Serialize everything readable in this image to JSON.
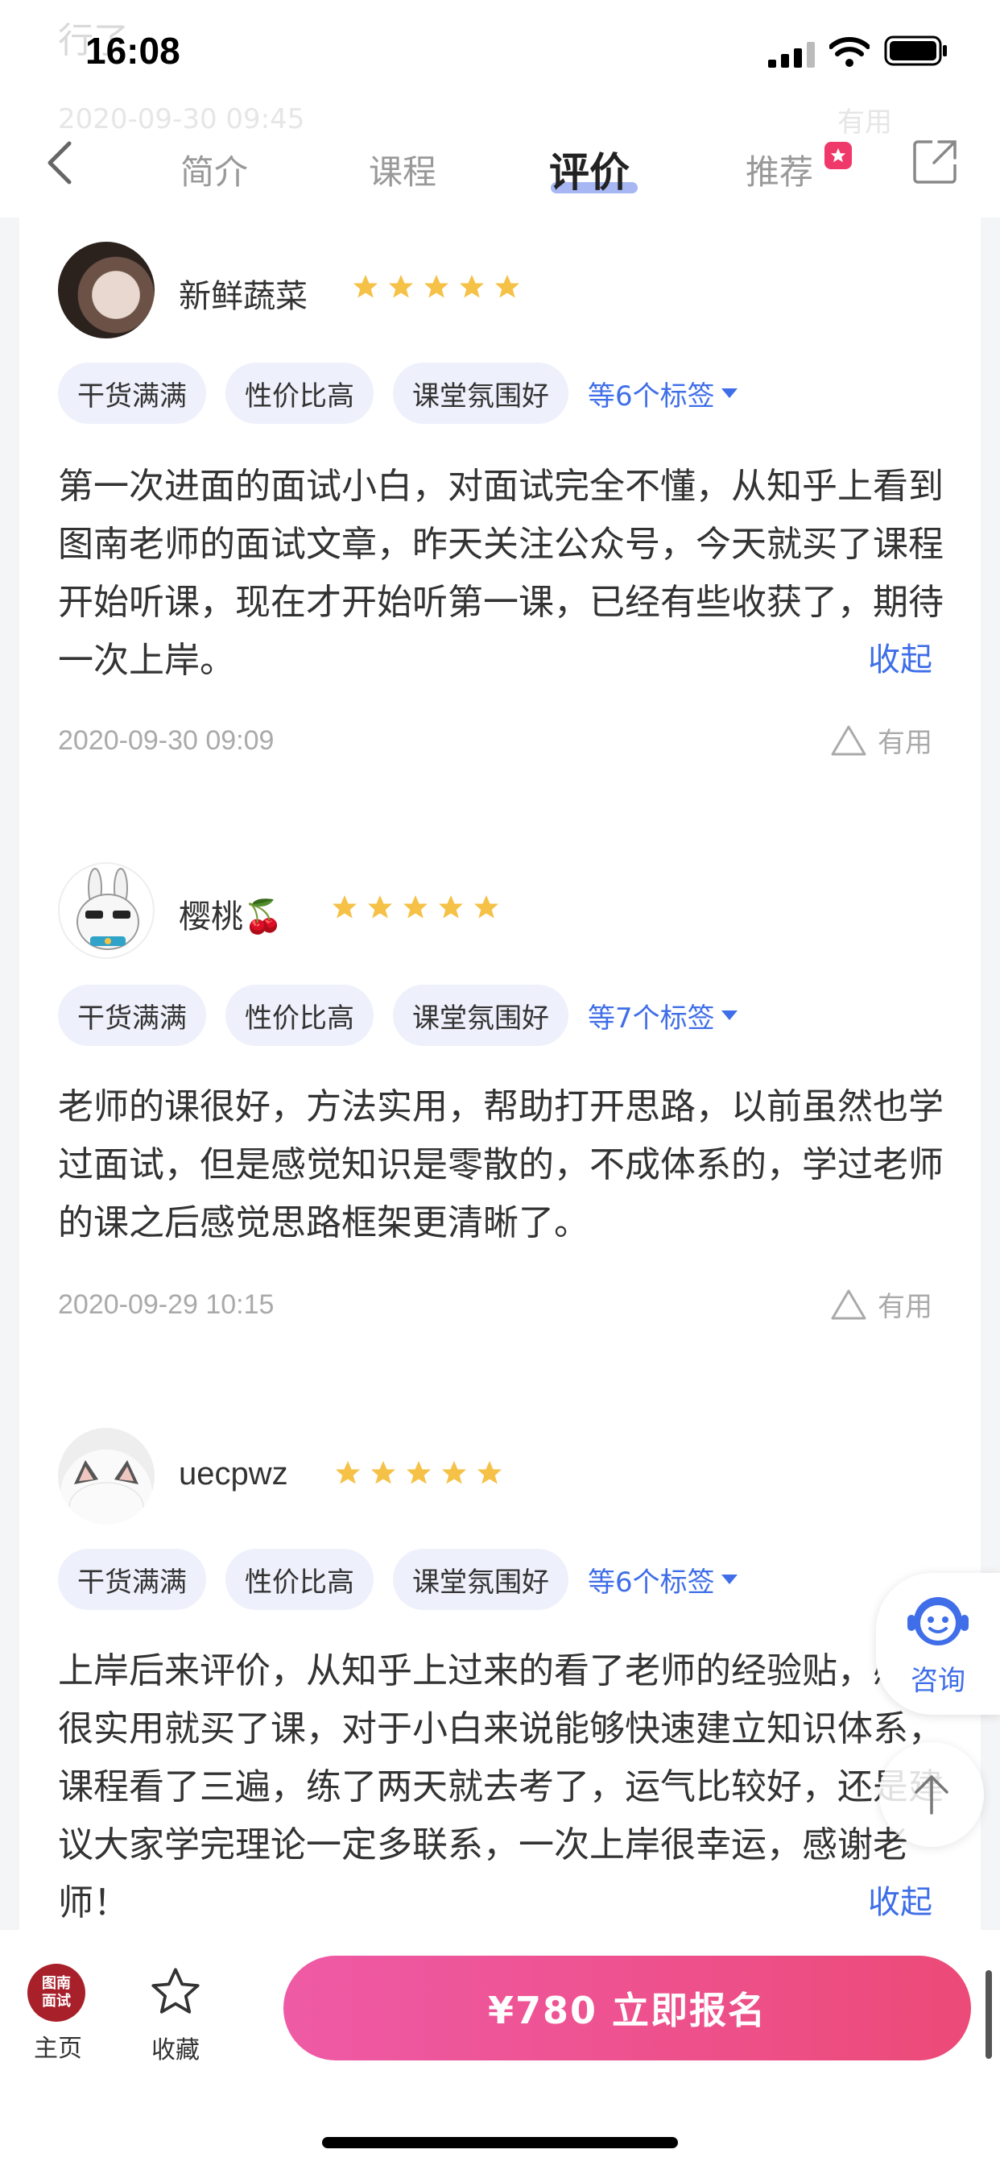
{
  "status_bar": {
    "time": "16:08"
  },
  "ghost": {
    "top_text": "行了",
    "date": "2020-09-30 09:45",
    "useful": "有用"
  },
  "nav": {
    "tabs": [
      {
        "label": "简介"
      },
      {
        "label": "课程"
      },
      {
        "label": "评价"
      },
      {
        "label": "推荐"
      }
    ],
    "active_tab": "评价",
    "badge_color": "#f0396b"
  },
  "reviews": [
    {
      "username": "新鲜蔬菜",
      "rating": 5,
      "tags": [
        "干货满满",
        "性价比高",
        "课堂氛围好"
      ],
      "more_tags": "等6个标签",
      "text": "第一次进面的面试小白，对面试完全不懂，从知乎上看到图南老师的面试文章，昨天关注公众号，今天就买了课程开始听课，现在才开始听第一课，已经有些收获了，期待一次上岸。",
      "collapse_label": "收起",
      "date": "2020-09-30 09:09",
      "useful_label": "有用"
    },
    {
      "username": "樱桃🍒",
      "rating": 5,
      "tags": [
        "干货满满",
        "性价比高",
        "课堂氛围好"
      ],
      "more_tags": "等7个标签",
      "text": "老师的课很好，方法实用，帮助打开思路，以前虽然也学过面试，但是感觉知识是零散的，不成体系的，学过老师的课之后感觉思路框架更清晰了。",
      "date": "2020-09-29 10:15",
      "useful_label": "有用"
    },
    {
      "username": "uecpwz",
      "rating": 5,
      "tags": [
        "干货满满",
        "性价比高",
        "课堂氛围好"
      ],
      "more_tags": "等6个标签",
      "text": "上岸后来评价，从知乎上过来的看了老师的经验贴，感觉很实用就买了课，对于小白来说能够快速建立知识体系，课程看了三遍，练了两天就去考了，运气比较好，还是建议大家学完理论一定多联系，一次上岸很幸运，感谢老师！",
      "collapse_label": "收起"
    }
  ],
  "floating": {
    "consult_label": "咨询"
  },
  "bottom_bar": {
    "home_label": "主页",
    "logo_line1": "图南",
    "logo_line2": "面试",
    "favorite_label": "收藏",
    "cta_label": "¥780  立即报名"
  },
  "colors": {
    "accent": "#3f6ee8",
    "cta_start": "#ef5aa6",
    "cta_end": "#ec4a78",
    "star": "#f5c146"
  }
}
